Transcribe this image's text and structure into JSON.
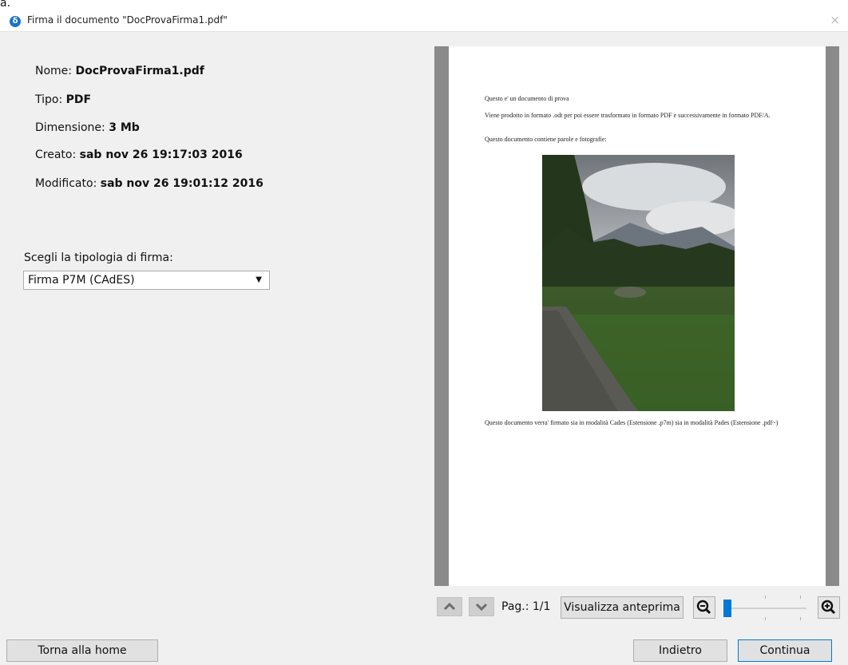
{
  "window": {
    "stray_char": "a.",
    "title": "Firma il documento \"DocProvaFirma1.pdf\"",
    "close_glyph": "×",
    "app_icon_glyph": "δ"
  },
  "info": {
    "nome_label": "Nome: ",
    "nome_value": "DocProvaFirma1.pdf",
    "tipo_label": "Tipo: ",
    "tipo_value": "PDF",
    "dimensione_label": "Dimensione: ",
    "dimensione_value": "3 Mb",
    "creato_label": "Creato: ",
    "creato_value": "sab nov 26 19:17:03 2016",
    "modificato_label": "Modificato: ",
    "modificato_value": "sab nov 26 19:01:12 2016"
  },
  "signature": {
    "label": "Scegli la tipologia di firma:",
    "selected": "Firma P7M (CAdES)"
  },
  "preview": {
    "line1": "Questo e' un documento di prova",
    "line2": "Viene prodotto in formato .odt per poi essere trasformato in formato PDF e successivamente in formato PDF/A.",
    "line3": "Questo documento contiene parole e fotografie:",
    "line4": "Questo documento verra' firmato sia in modalità Cades (Estensione .p7m) sia in modalità Pades (Estensione .pdf~)"
  },
  "toolbar": {
    "page_label": "Pag.: 1/1",
    "preview_button": "Visualizza anteprima",
    "zoom_level": 0.0
  },
  "footer": {
    "home_button": "Torna alla home",
    "back_button": "Indietro",
    "continue_button": "Continua"
  },
  "colors": {
    "accent": "#0078d7",
    "preview_background": "#8a8a8a",
    "app_icon": "#1a73c9"
  },
  "icons": [
    "app-logo-icon",
    "close-icon",
    "chevron-up-icon",
    "chevron-down-icon",
    "zoom-out-icon",
    "zoom-in-icon",
    "dropdown-caret-icon"
  ]
}
